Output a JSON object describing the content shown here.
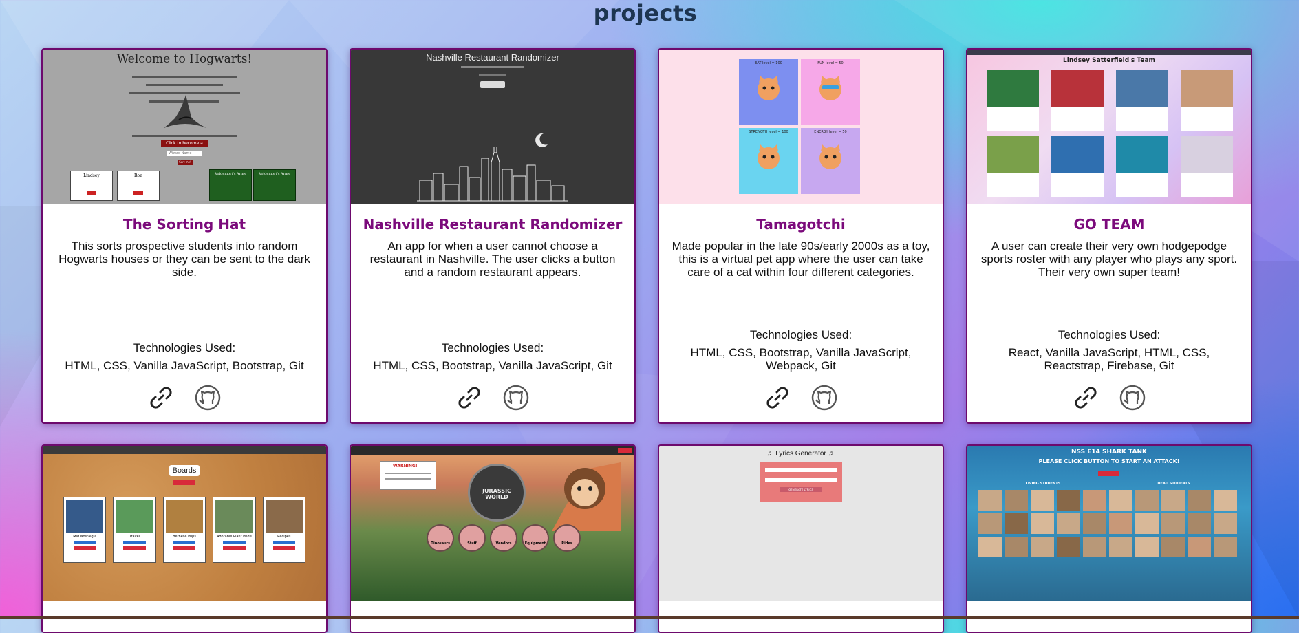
{
  "section": {
    "title": "projects"
  },
  "projects": [
    {
      "title": "The Sorting Hat",
      "description": "This sorts prospective students into random Hogwarts houses or they can be sent to the dark side.",
      "tech_label": "Technologies Used:",
      "tech": "HTML, CSS, Vanilla JavaScript, Bootstrap, Git",
      "thumb": {
        "heading": "Welcome to Hogwarts!",
        "button": "Click to become a wizard",
        "input_placeholder": "Wizard Name",
        "submit": "Sort me!",
        "students": [
          "Lindsey",
          "Ron"
        ],
        "army": [
          "Voldemort's Army",
          "Voldemort's Army"
        ]
      }
    },
    {
      "title": "Nashville Restaurant Randomizer",
      "description": "An app for when a user cannot choose a restaurant in Nashville. The user clicks a button and a random restaurant appears.",
      "tech_label": "Technologies Used:",
      "tech": "HTML, CSS, Bootstrap, Vanilla JavaScript, Git",
      "thumb": {
        "heading": "Nashville Restaurant Randomizer"
      }
    },
    {
      "title": "Tamagotchi",
      "description": "Made popular in the late 90s/early 2000s as a toy, this is a virtual pet app where the user can take care of a cat within four different categories.",
      "tech_label": "Technologies Used:",
      "tech": "HTML, CSS, Bootstrap, Vanilla JavaScript, Webpack, Git",
      "thumb": {
        "panels": [
          "EAT level = 100",
          "FUN level = 50",
          "STRENGTH level = 100",
          "ENERGY level = 50"
        ]
      }
    },
    {
      "title": "GO TEAM",
      "description": "A user can create their very own hodgepodge sports roster with any player who plays any sport. Their very own super team!",
      "tech_label": "Technologies Used:",
      "tech": "React, Vanilla JavaScript, HTML, CSS, Reactstrap, Firebase, Git",
      "thumb": {
        "heading": "Lindsey Satterfield's Team"
      }
    },
    {
      "title": "",
      "thumb": {
        "heading": "Boards",
        "boards": [
          "Mid Nostalgia",
          "Travel",
          "Bernese Pups",
          "Adorable Plant Pride",
          "Recipes"
        ]
      }
    },
    {
      "title": "",
      "thumb": {
        "logo": "JURASSIC WORLD",
        "buttons": [
          "Dinosaurs",
          "Staff",
          "Vendors",
          "Equipment",
          "Rides"
        ],
        "warning": "WARNING!"
      }
    },
    {
      "title": "",
      "thumb": {
        "heading": "♬ Lyrics Generator ♬",
        "button": "GENERATE LYRICS"
      }
    },
    {
      "title": "",
      "thumb": {
        "heading": "NSS E14 SHARK TANK",
        "sub": "PLEASE CLICK BUTTON TO START AN ATTACK!",
        "left": "LIVING STUDENTS",
        "right": "DEAD STUDENTS"
      }
    }
  ],
  "colors": {
    "accent": "#7b0a7b",
    "card_border": "#6d0a6d",
    "title": "#1d3550"
  },
  "icons": {
    "live": "link-icon",
    "repo": "github-icon"
  }
}
